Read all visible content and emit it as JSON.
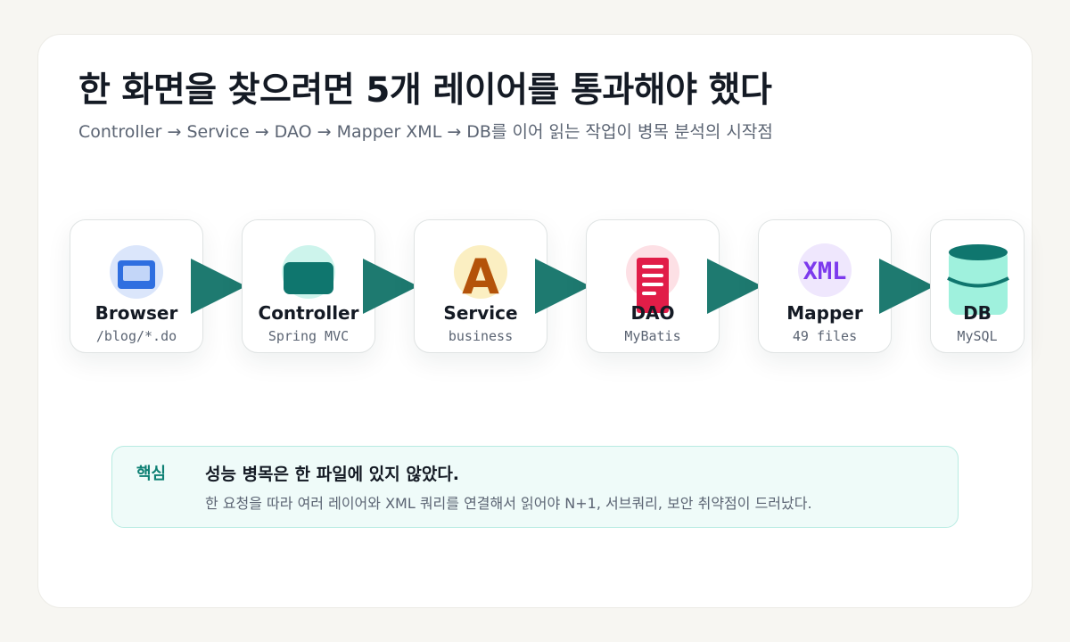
{
  "header": {
    "title": "한 화면을 찾으려면 5개 레이어를 통과해야 했다",
    "subtitle": "Controller → Service → DAO → Mapper XML → DB를 이어 읽는 작업이 병목 분석의 시작점"
  },
  "flow": {
    "nodes": [
      {
        "name": "Browser",
        "sub": "/blog/*.do",
        "icon": "browser-window-icon",
        "color": "#2f6fe0"
      },
      {
        "name": "Controller",
        "sub": "Spring MVC",
        "icon": "controller-block-icon",
        "color": "#0f766e"
      },
      {
        "name": "Service",
        "sub": "business",
        "icon": "letter-a-icon",
        "color": "#b4530a"
      },
      {
        "name": "DAO",
        "sub": "MyBatis",
        "icon": "document-list-icon",
        "color": "#e11d48"
      },
      {
        "name": "Mapper",
        "sub": "49 files",
        "icon": "xml-text-icon",
        "color": "#7c3aed"
      },
      {
        "name": "DB",
        "sub": "MySQL",
        "icon": "database-cylinder-icon",
        "color": "#0f766e"
      }
    ],
    "icon_text": {
      "service_letter": "A",
      "mapper_xml": "XML"
    },
    "arrow_color": "#1e7a70"
  },
  "callout": {
    "label": "핵심",
    "headline": "성능 병목은 한 파일에 있지 않았다.",
    "body": "한 요청을 따라 여러 레이어와 XML 쿼리를 연결해서 읽어야 N+1, 서브쿼리, 보안 취약점이 드러났다."
  }
}
